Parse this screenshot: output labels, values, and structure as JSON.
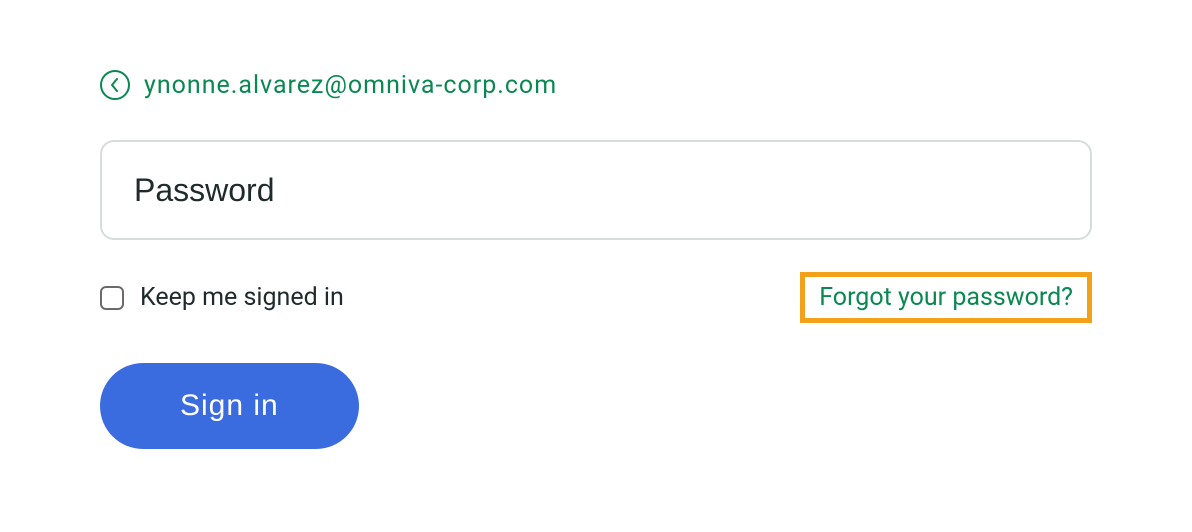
{
  "email_row": {
    "email": "ynonne.alvarez@omniva-corp.com"
  },
  "password_field": {
    "placeholder": "Password",
    "value": ""
  },
  "options": {
    "keep_signed_label": "Keep me signed in",
    "forgot_password_label": "Forgot your password?"
  },
  "actions": {
    "sign_in_label": "Sign in"
  },
  "colors": {
    "accent_green": "#0a8852",
    "highlight_orange": "#f4a11a",
    "primary_blue": "#3a6bdf"
  }
}
